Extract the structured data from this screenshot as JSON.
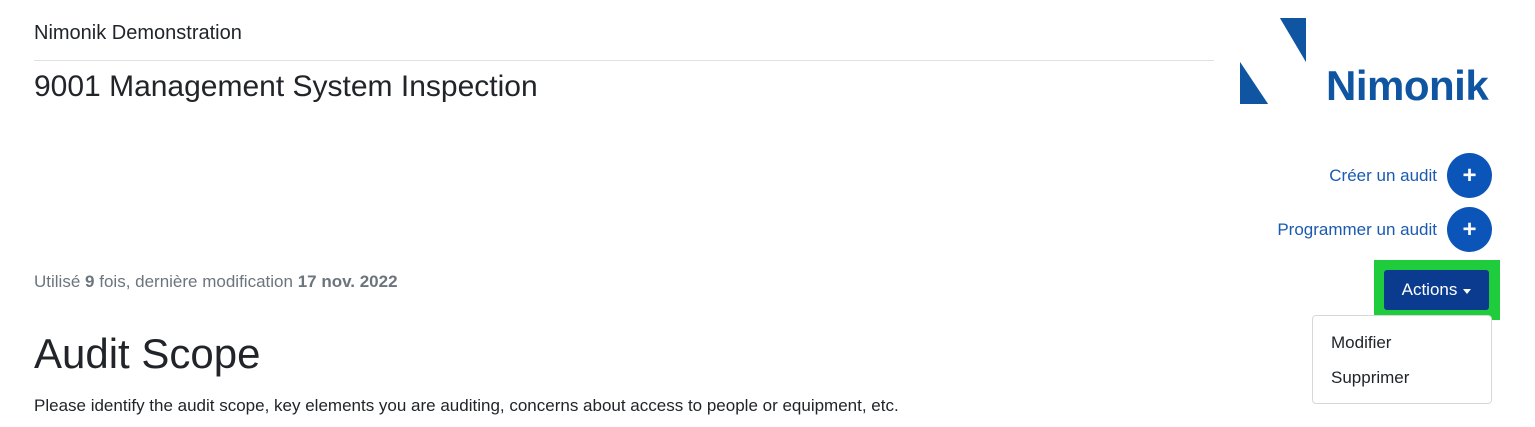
{
  "header": {
    "organization": "Nimonik Demonstration",
    "template_title": "9001 Management System Inspection"
  },
  "logo": {
    "text": "Nimonik",
    "color": "#0f55a1"
  },
  "actions": {
    "create_audit_label": "Créer un audit",
    "schedule_audit_label": "Programmer un audit",
    "plus_icon": "+",
    "actions_button_label": "Actions",
    "menu_items": [
      "Modifier",
      "Supprimer"
    ]
  },
  "usage": {
    "prefix": "Utilisé",
    "count": "9",
    "middle": "fois, dernière modification",
    "date": "17 nov. 2022"
  },
  "section": {
    "heading": "Audit Scope",
    "description": "Please identify the audit scope, key elements you are auditing, concerns about access to people or equipment, etc."
  },
  "colors": {
    "accent": "#0c55b8",
    "actions_button": "#0b3b8f",
    "highlight": "#1fcc3c"
  }
}
